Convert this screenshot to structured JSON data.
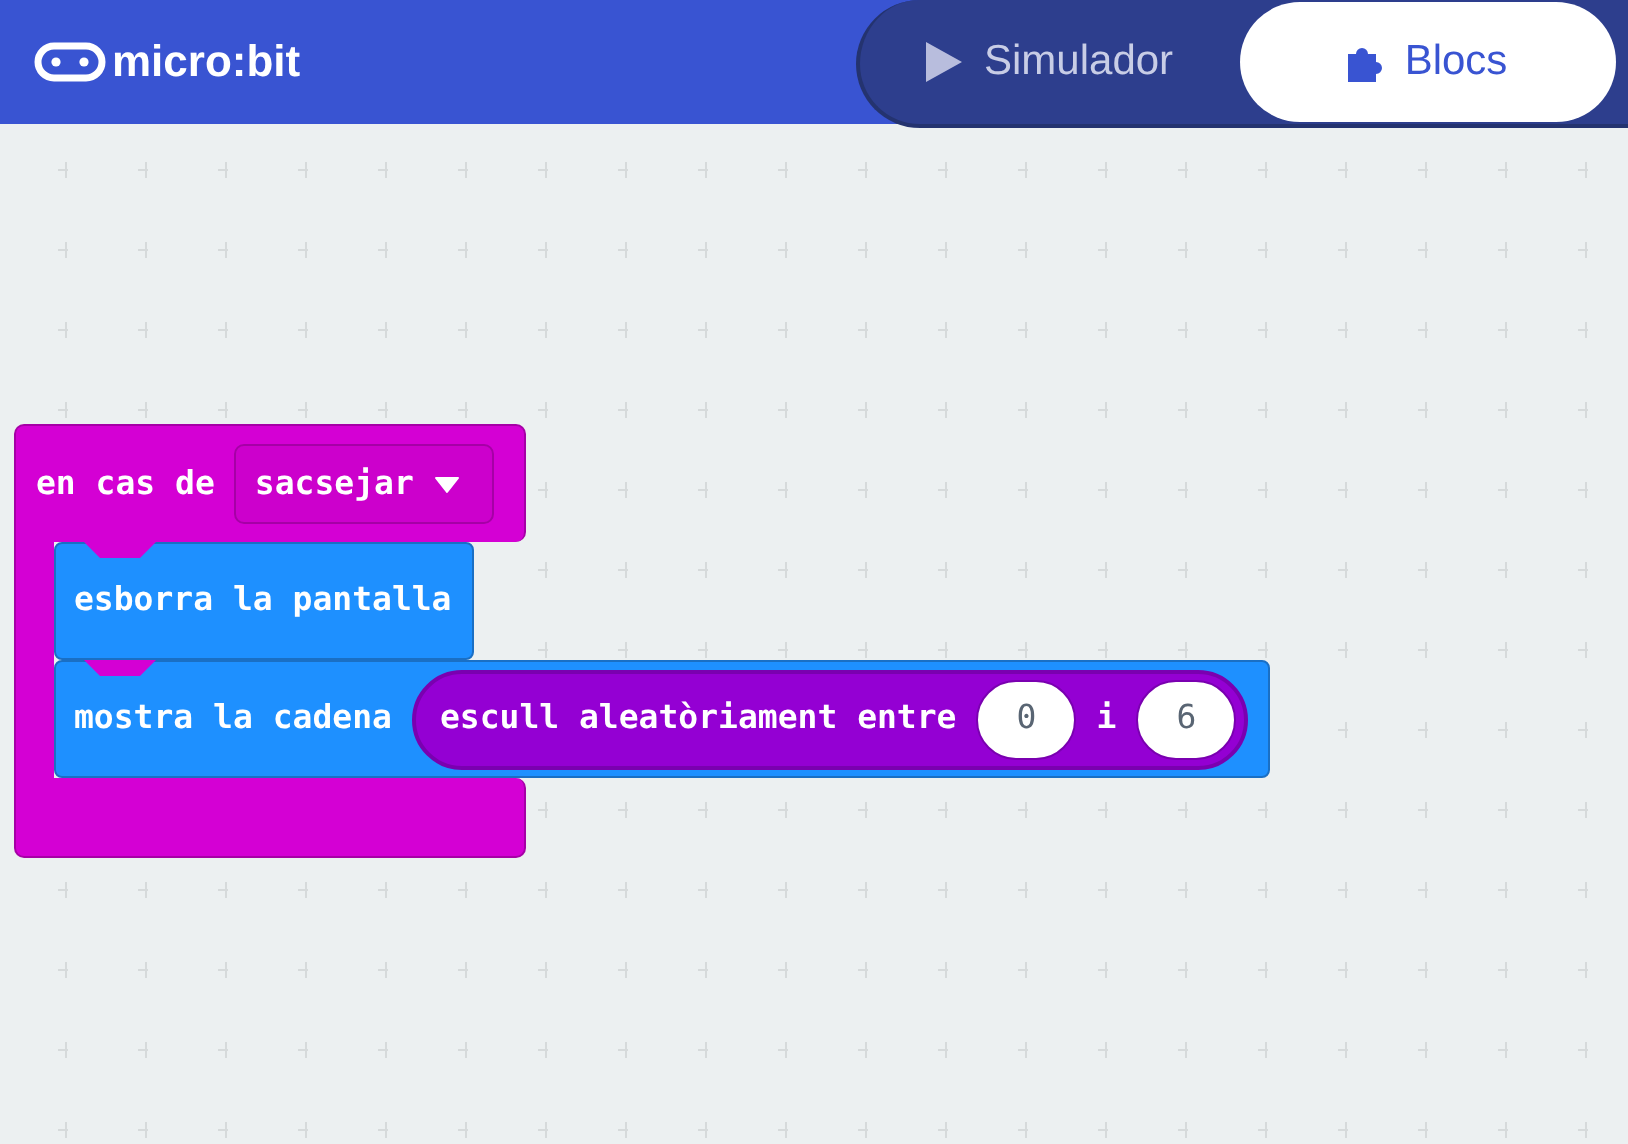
{
  "header": {
    "logo": "micro:bit"
  },
  "tabs": [
    {
      "label": "Simulador",
      "kind": "play",
      "selected": false
    },
    {
      "label": "Blocs",
      "kind": "puzzle",
      "selected": true
    }
  ],
  "workspace": {
    "event_block": {
      "label": "en cas de",
      "dropdown": "sacsejar",
      "statements": [
        {
          "kind": "plain",
          "label": "esborra la pantalla"
        },
        {
          "kind": "with_reporter",
          "label": "mostra la cadena",
          "reporter": {
            "label": "escull aleatòriament entre",
            "min": "0",
            "joiner": "i",
            "max": "6"
          }
        }
      ]
    }
  }
}
